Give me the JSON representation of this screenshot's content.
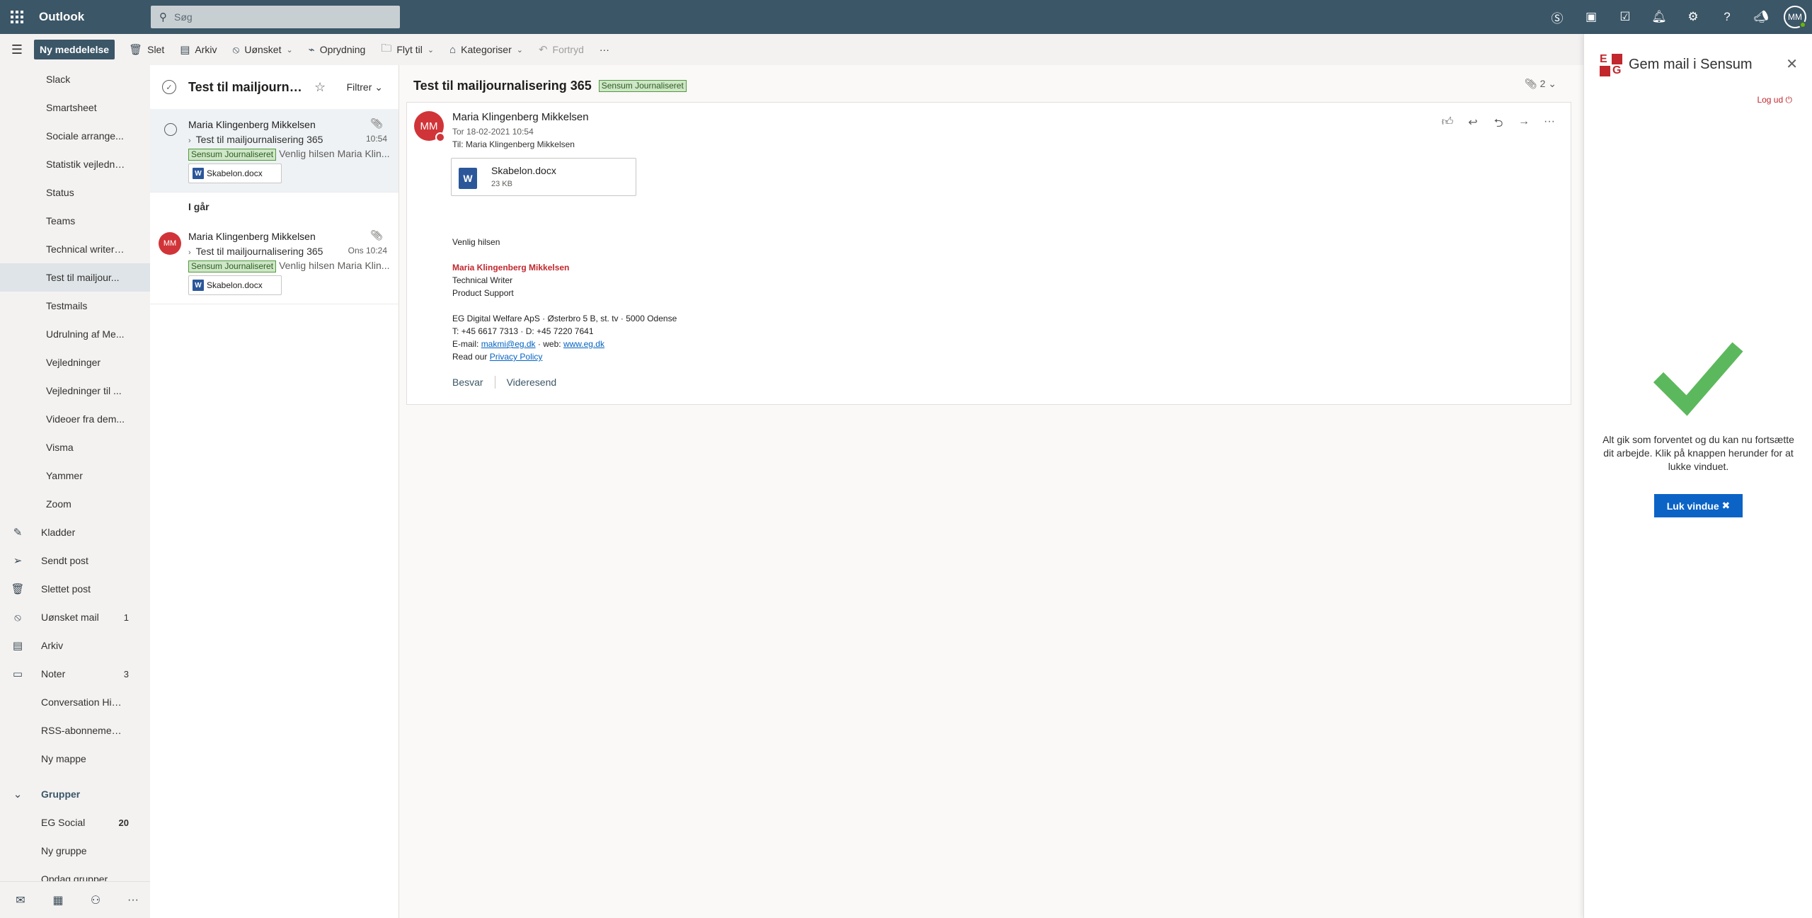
{
  "header": {
    "app_name": "Outlook",
    "search_placeholder": "Søg",
    "avatar_initials": "MM",
    "icons": [
      "skype-icon",
      "office-icon",
      "todo-icon",
      "bell-icon",
      "gear-icon",
      "help-icon",
      "megaphone-icon"
    ]
  },
  "toolbar": {
    "new_message": "Ny meddelelse",
    "delete": "Slet",
    "archive": "Arkiv",
    "junk": "Uønsket",
    "sweep": "Oprydning",
    "move": "Flyt til",
    "categories": "Kategoriser",
    "undo": "Fortryd",
    "more": "···"
  },
  "folders": {
    "items": [
      {
        "label": "Slack"
      },
      {
        "label": "Smartsheet"
      },
      {
        "label": "Sociale arrange..."
      },
      {
        "label": "Statistik vejledni..."
      },
      {
        "label": "Status"
      },
      {
        "label": "Teams"
      },
      {
        "label": "Technical writer ..."
      },
      {
        "label": "Test til mailjour..."
      },
      {
        "label": "Testmails"
      },
      {
        "label": "Udrulning af Me..."
      },
      {
        "label": "Vejledninger"
      },
      {
        "label": "Vejledninger til ..."
      },
      {
        "label": "Videoer fra dem..."
      },
      {
        "label": "Visma"
      },
      {
        "label": "Yammer"
      },
      {
        "label": "Zoom"
      }
    ],
    "top_items": [
      {
        "label": "Kladder",
        "count": ""
      },
      {
        "label": "Sendt post",
        "count": ""
      },
      {
        "label": "Slettet post",
        "count": ""
      },
      {
        "label": "Uønsket mail",
        "count": "1"
      },
      {
        "label": "Arkiv",
        "count": ""
      },
      {
        "label": "Noter",
        "count": "3"
      },
      {
        "label": "Conversation Hist...",
        "count": ""
      },
      {
        "label": "RSS-abonnementer",
        "count": ""
      },
      {
        "label": "Ny mappe",
        "count": ""
      }
    ],
    "groups_header": "Grupper",
    "groups": [
      {
        "label": "EG Social",
        "count": "20"
      },
      {
        "label": "Ny gruppe",
        "count": ""
      },
      {
        "label": "Opdag grupper",
        "count": ""
      }
    ]
  },
  "message_list": {
    "title": "Test til mailjournali...",
    "filter": "Filtrer",
    "day_group": "I går",
    "messages": [
      {
        "sender": "Maria Klingenberg Mikkelsen",
        "subject": "Test til mailjournalisering 365",
        "time": "10:54",
        "tag": "Sensum Journaliseret",
        "preview": "Venlig hilsen Maria Klin...",
        "attachment": "Skabelon.docx"
      },
      {
        "sender": "Maria Klingenberg Mikkelsen",
        "subject": "Test til mailjournalisering 365",
        "time": "Ons 10:24",
        "tag": "Sensum Journaliseret",
        "preview": "Venlig hilsen Maria Klin...",
        "attachment": "Skabelon.docx",
        "initials": "MM"
      }
    ]
  },
  "reading_pane": {
    "subject": "Test til mailjournalisering 365",
    "tag": "Sensum Journaliseret",
    "attachment_count": "2",
    "sender": "Maria Klingenberg Mikkelsen",
    "initials": "MM",
    "date": "Tor 18-02-2021 10:54",
    "to_label": "Til:",
    "to": "Maria Klingenberg Mikkelsen",
    "attachment": {
      "name": "Skabelon.docx",
      "size": "23 KB"
    },
    "body": {
      "greeting": "Venlig hilsen",
      "name": "Maria Klingenberg Mikkelsen",
      "title": "Technical Writer",
      "department": "Product Support",
      "address": "EG Digital Welfare ApS · Østerbro 5 B, st. tv · 5000 Odense",
      "phone": "T: +45 6617 7313 · D: +45 7220 7641",
      "email_label": "E-mail:",
      "email": "makmi@eg.dk",
      "web_label": "· web:",
      "web": "www.eg.dk",
      "read_label": "Read our",
      "privacy": "Privacy Policy"
    },
    "reply": "Besvar",
    "forward": "Videresend"
  },
  "addin": {
    "title": "Gem mail i Sensum",
    "logout": "Log ud",
    "message": "Alt gik som forventet og du kan nu fortsætte dit arbejde. Klik på knappen herunder for at lukke vinduet.",
    "close_button": "Luk vindue",
    "close_symbol": "✖"
  },
  "colors": {
    "header_bg": "#3b5667",
    "accent_red": "#c1272d",
    "success_green": "#5cb85c",
    "button_blue": "#0b63c6",
    "tag_green": "#cfe6c8"
  }
}
